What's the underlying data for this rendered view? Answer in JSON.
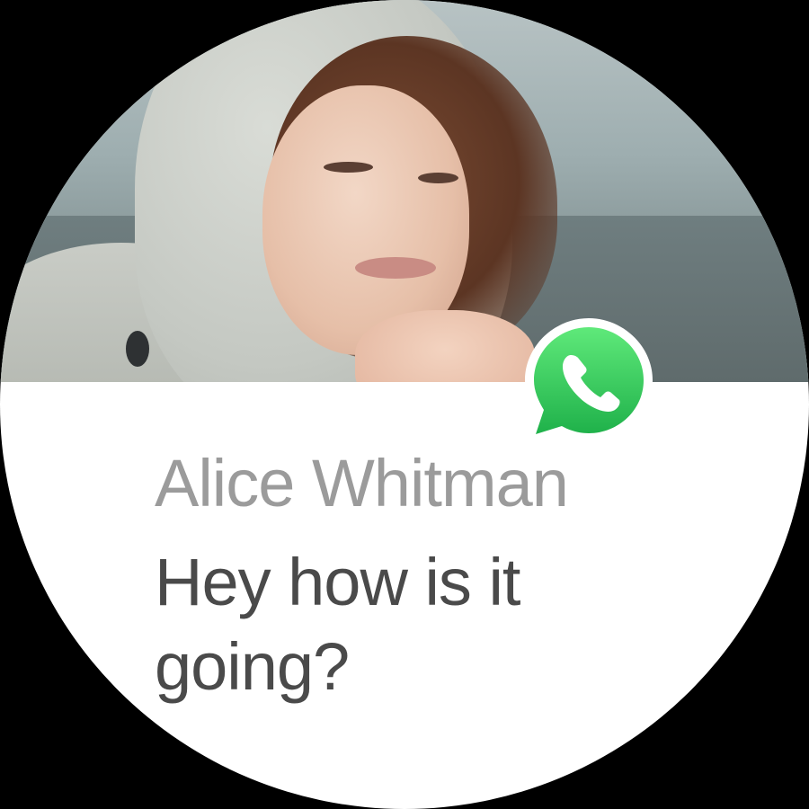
{
  "notification": {
    "app_icon": "whatsapp-icon",
    "contact_name": "Alice Whitman",
    "message": "Hey how is it going?",
    "photo": "contact-photo"
  },
  "colors": {
    "background": "#000000",
    "card": "#ffffff",
    "name_text": "#9b9b9b",
    "message_text": "#4a4a4a",
    "whatsapp_green": "#25d366"
  }
}
